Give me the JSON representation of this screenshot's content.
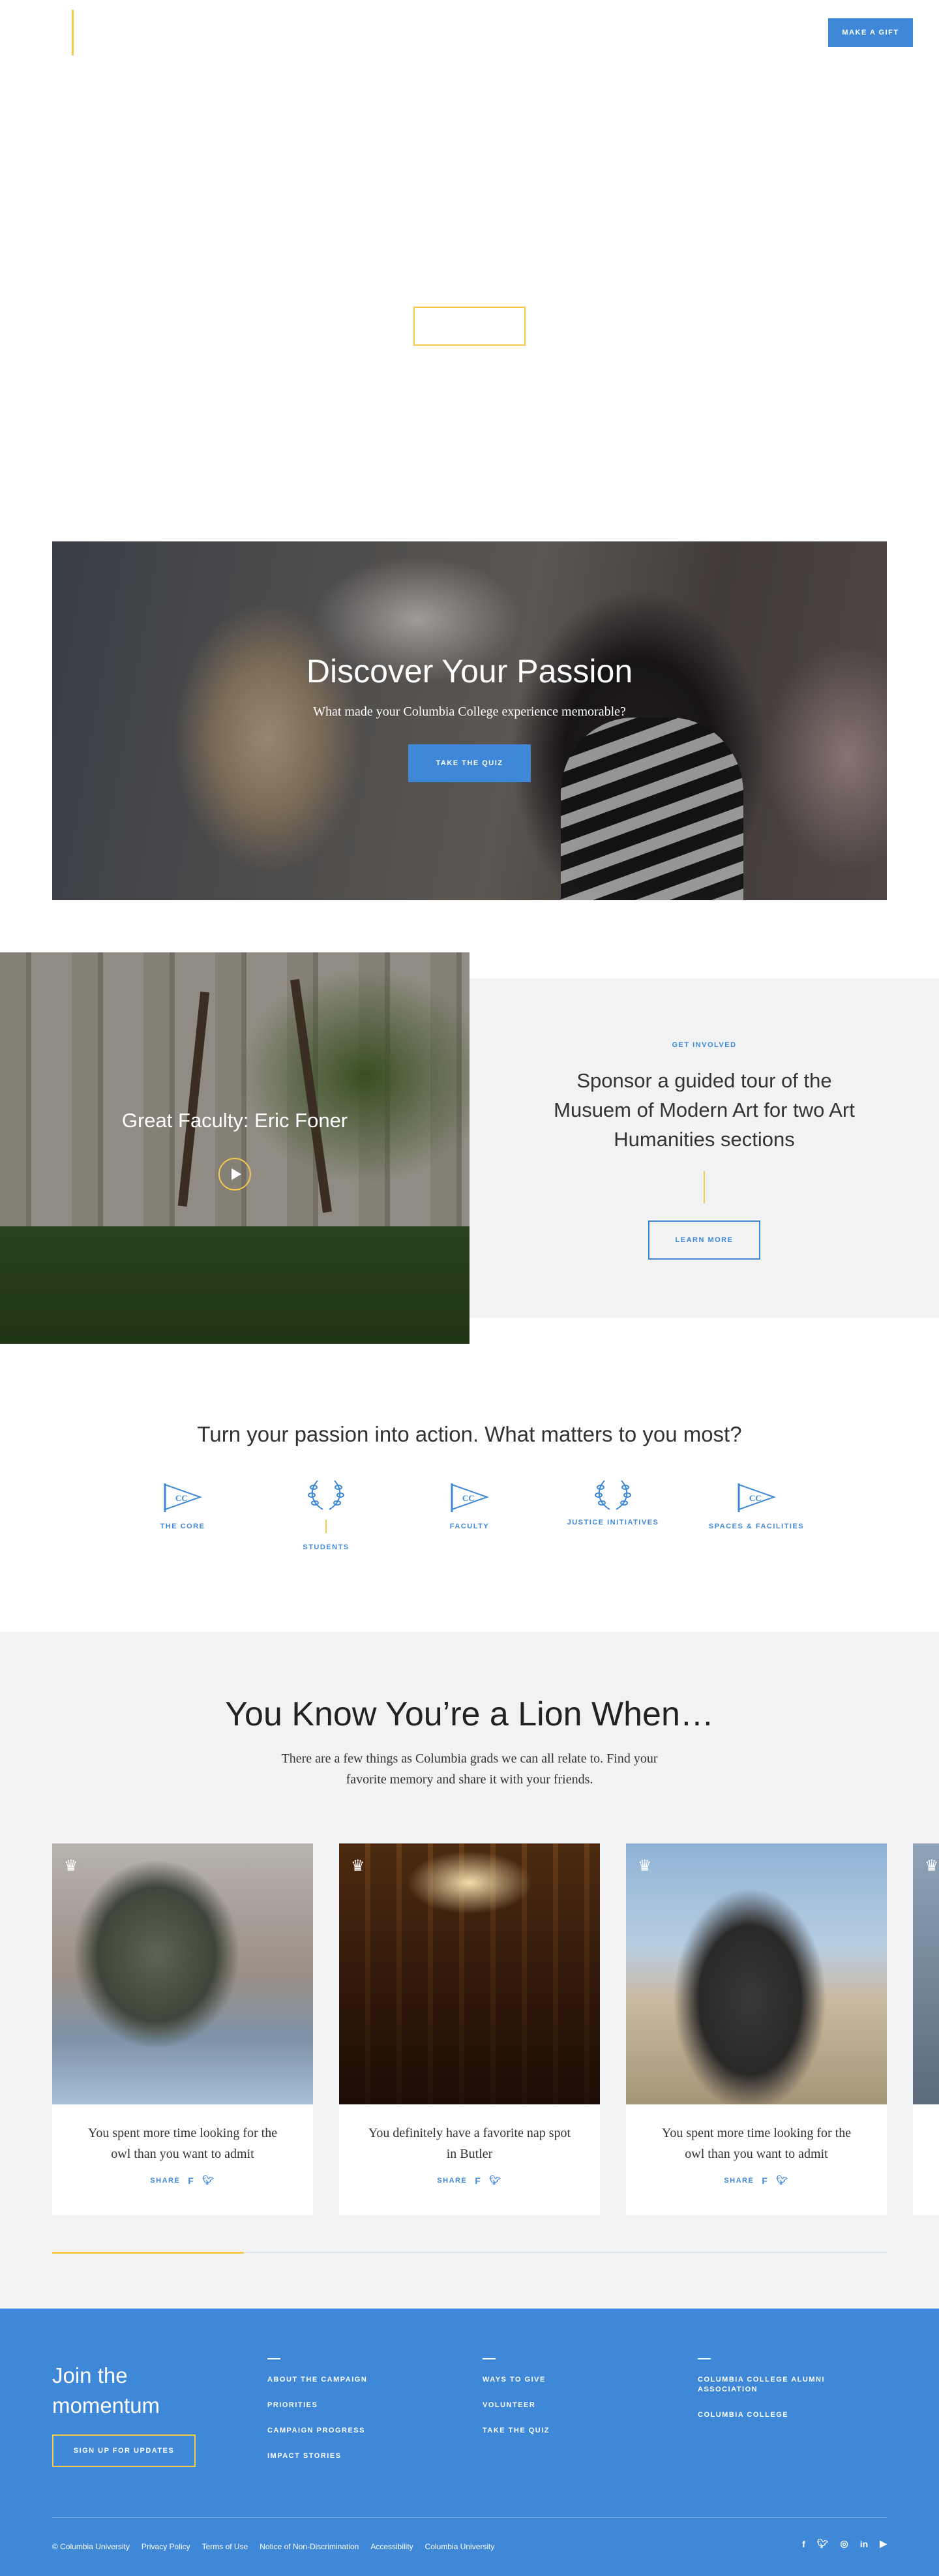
{
  "header": {
    "gift_label": "MAKE A GIFT"
  },
  "colors": {
    "brand_blue": "#3f88d8",
    "accent_yellow": "#f5c94a",
    "light_bg": "#f0f2f4"
  },
  "passion": {
    "title": "Discover Your Passion",
    "subtitle": "What made your Columbia College experience memorable?",
    "cta": "TAKE THE QUIZ"
  },
  "video": {
    "title": "Great Faculty: Eric Foner",
    "icon": "play-icon"
  },
  "involve": {
    "label": "GET INVOLVED",
    "title": "Sponsor a guided tour of the Musuem of Modern Art for two Art Humanities sections",
    "cta": "LEARN MORE"
  },
  "matters": {
    "title": "Turn your passion into action. What matters to you most?",
    "tiles": [
      {
        "label": "THE CORE",
        "icon": "pennant-icon"
      },
      {
        "label": "STUDENTS",
        "icon": "laurel-icon"
      },
      {
        "label": "FACULTY",
        "icon": "pennant-icon"
      },
      {
        "label": "JUSTICE INITIATIVES",
        "icon": "laurel-icon"
      },
      {
        "label": "SPACES & FACILITIES",
        "icon": "pennant-icon"
      }
    ]
  },
  "lion": {
    "title": "You Know You’re a Lion When…",
    "subtitle": "There are a few things as Columbia grads we can all relate to. Find your favorite memory and share it with your friends.",
    "cards": [
      {
        "text": "You spent more time looking for the owl than you want to admit",
        "share": "SHARE"
      },
      {
        "text": "You definitely have a favorite nap spot in Butler",
        "share": "SHARE"
      },
      {
        "text": "You spent more time looking for the owl than you want to admit",
        "share": "SHARE"
      }
    ],
    "carousel_progress": 0.23
  },
  "footer": {
    "join": "Join the momentum",
    "signup": "SIGN UP FOR UPDATES",
    "col1": [
      "ABOUT THE CAMPAIGN",
      "PRIORITIES",
      "CAMPAIGN PROGRESS",
      "IMPACT STORIES"
    ],
    "col2": [
      "WAYS TO GIVE",
      "VOLUNTEER",
      "TAKE THE QUIZ"
    ],
    "col3": [
      "COLUMBIA COLLEGE ALUMNI ASSOCIATION",
      "COLUMBIA COLLEGE"
    ],
    "legal": [
      "© Columbia University",
      "Privacy Policy",
      "Terms of Use",
      "Notice of Non-Discrimination",
      "Accessibility",
      "Columbia University"
    ],
    "social": [
      "facebook-icon",
      "twitter-icon",
      "instagram-icon",
      "linkedin-icon",
      "youtube-icon"
    ]
  }
}
